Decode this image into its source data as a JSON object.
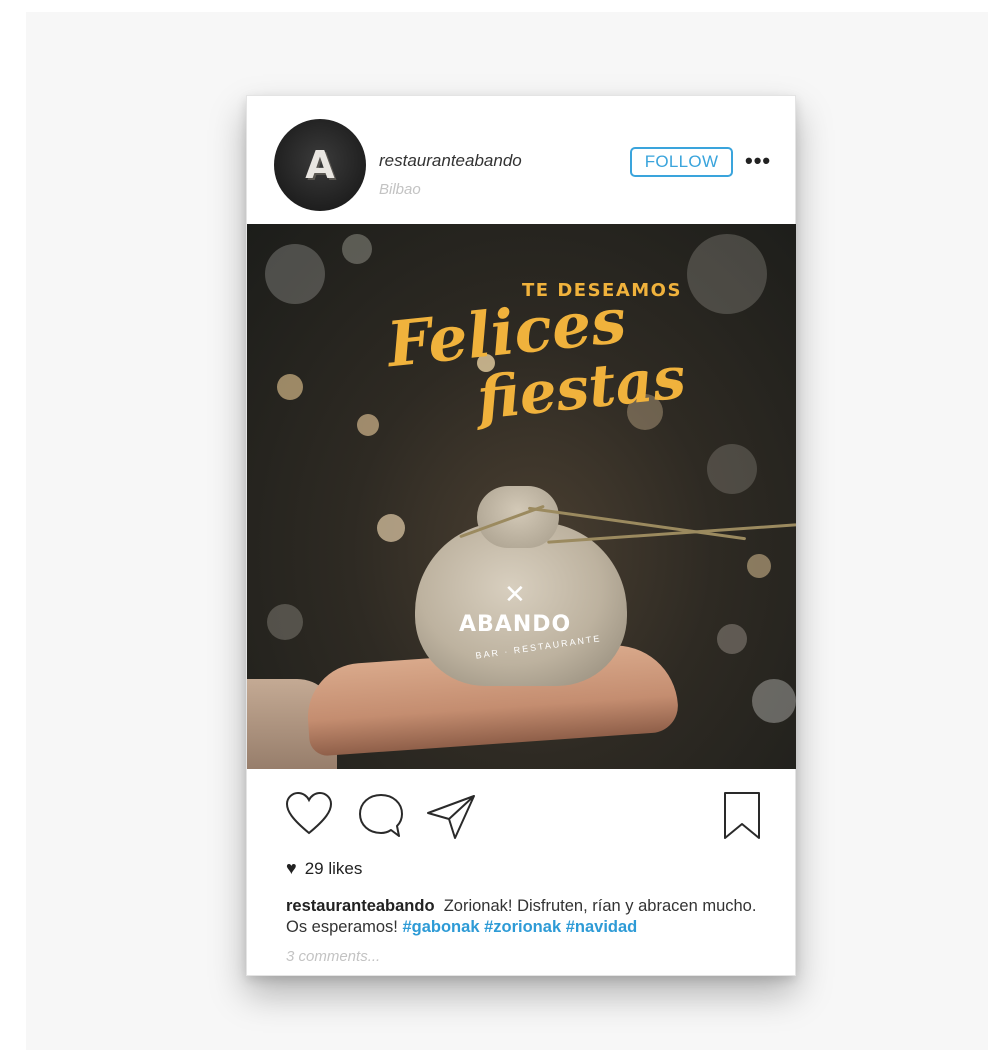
{
  "post": {
    "username": "restauranteabando",
    "location": "Bilbao",
    "avatar_letter": "A",
    "follow_label": "FOLLOW",
    "more_label": "•••"
  },
  "image": {
    "headline_small": "TE DESEAMOS",
    "headline_script_1": "Felices",
    "headline_script_2": "fiestas",
    "logo_name": "ABANDO",
    "logo_sub": "BAR · RESTAURANTE",
    "accent_color": "#f0b23c"
  },
  "actions": {
    "icons": [
      "heart-icon",
      "comment-icon",
      "share-icon",
      "bookmark-icon"
    ]
  },
  "likes": {
    "text": "29 likes"
  },
  "caption": {
    "user": "restauranteabando",
    "text": "Zorionak! Disfruten, rían y abracen mucho. Os esperamos!",
    "tags": [
      "#gabonak",
      "#zorionak",
      "#navidad"
    ]
  },
  "comments_link": "3 comments...",
  "colors": {
    "link_blue": "#2e9bd6",
    "follow_blue": "#3aa4dc"
  }
}
